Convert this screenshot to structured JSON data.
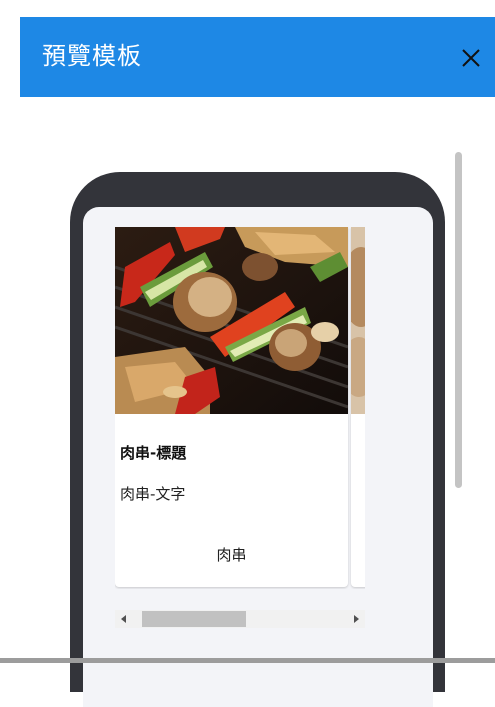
{
  "header": {
    "title": "預覽模板",
    "close_icon": "close-icon",
    "background": "#1e88e5"
  },
  "card": {
    "image": "grilled-skewers-photo",
    "title": "肉串-標題",
    "text": "肉串-文字",
    "button_label": "肉串"
  },
  "colors": {
    "phone_frame": "#33343a",
    "screen_bg": "#f3f4f8"
  }
}
